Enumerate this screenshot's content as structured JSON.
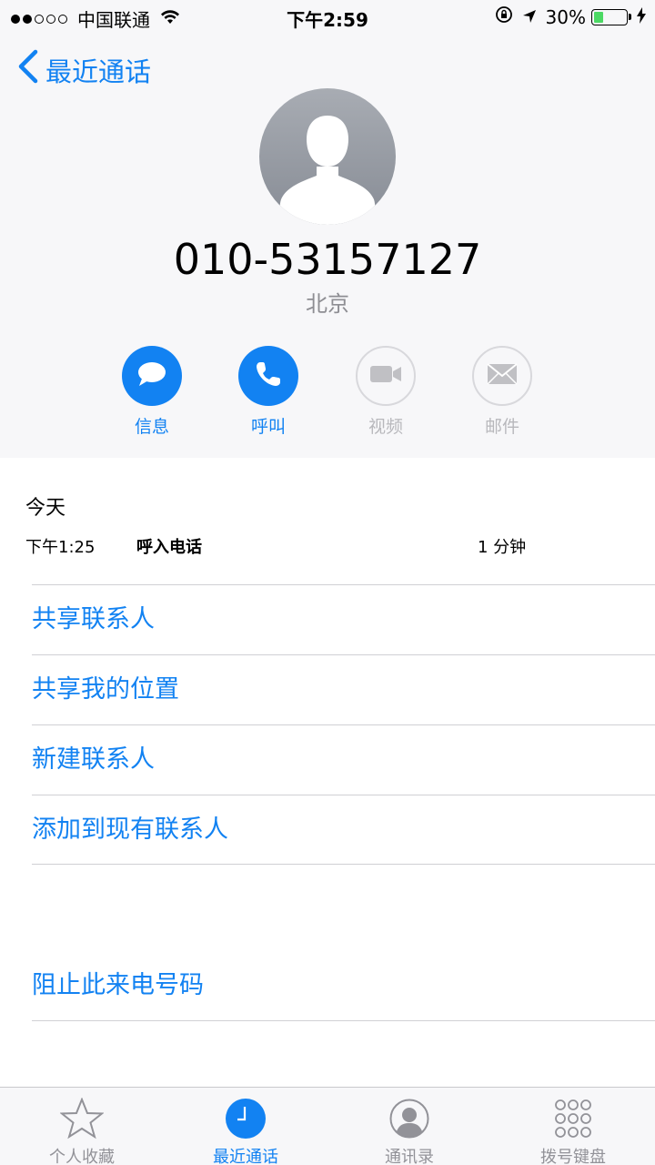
{
  "status_bar": {
    "carrier": "中国联通",
    "time": "下午2:59",
    "battery": "30%",
    "battery_level": 0.3,
    "signal_bars_filled": 2,
    "signal_bars_total": 5
  },
  "nav": {
    "back_label": "最近通话"
  },
  "contact": {
    "number": "010-53157127",
    "location": "北京"
  },
  "actions": [
    {
      "label": "信息",
      "icon": "message-icon",
      "enabled": true
    },
    {
      "label": "呼叫",
      "icon": "phone-icon",
      "enabled": true
    },
    {
      "label": "视频",
      "icon": "video-icon",
      "enabled": false
    },
    {
      "label": "邮件",
      "icon": "mail-icon",
      "enabled": false
    }
  ],
  "call_log": {
    "date_label": "今天",
    "entries": [
      {
        "time": "下午1:25",
        "type": "呼入电话",
        "duration": "1 分钟"
      }
    ]
  },
  "options": [
    {
      "label": "共享联系人"
    },
    {
      "label": "共享我的位置"
    },
    {
      "label": "新建联系人"
    },
    {
      "label": "添加到现有联系人"
    }
  ],
  "block": {
    "label": "阻止此来电号码"
  },
  "tabbar": {
    "tabs": [
      {
        "label": "个人收藏",
        "icon": "star-icon",
        "active": false
      },
      {
        "label": "最近通话",
        "icon": "clock-icon",
        "active": true
      },
      {
        "label": "通讯录",
        "icon": "contacts-icon",
        "active": false
      },
      {
        "label": "拨号键盘",
        "icon": "keypad-icon",
        "active": false
      }
    ]
  },
  "colors": {
    "accent": "#1282f2",
    "disabled": "#b8b8bc",
    "header_bg": "#f7f7f9",
    "battery": "#4cd964"
  }
}
